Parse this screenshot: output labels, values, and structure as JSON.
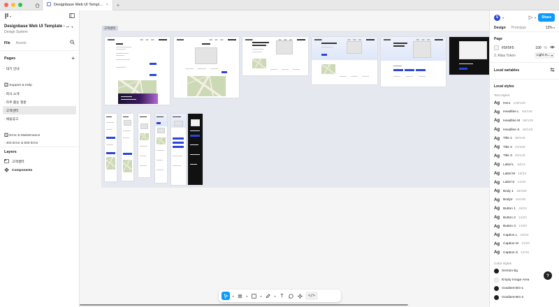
{
  "browser": {
    "tab_title": "Designbase Web UI Template - ∙",
    "traffic_lights": [
      "#ff5f57",
      "#febc2e",
      "#28c840"
    ],
    "new_tab": "+"
  },
  "left_panel": {
    "file_title": "Designbase Web UI Template - ...",
    "file_subtitle": "Design System",
    "tabs": [
      "File",
      "Assets"
    ],
    "pages_heading": "Pages",
    "add_symbol": "+",
    "pages": [
      "∙ 대기 안내",
      "",
      "🔲 Support & Help",
      "∙ 회사 소개",
      "∙ 자주 묻는 질문",
      "∙ 고객센터",
      "∙ 채용공고",
      "",
      "🔲 Error & Maintenance",
      "∙ 404 Error & 500 Error"
    ],
    "selected_page_index": 5,
    "layers_heading": "Layers",
    "layers": [
      {
        "label": "고객센터",
        "icon": "section-icon",
        "bold": false
      },
      {
        "label": "Components",
        "icon": "component-icon",
        "bold": true
      }
    ]
  },
  "canvas": {
    "section_label": "고객센터",
    "section_bg": "#e6e8f0"
  },
  "toolbar": {
    "tools": [
      "move-tool",
      "frame-tool",
      "shape-tool",
      "pen-tool",
      "text-tool",
      "comment-tool",
      "actions-tool",
      "dev-mode-tool"
    ],
    "text_glyph": "T",
    "code_glyph": "</>"
  },
  "right_panel": {
    "avatar_letter": "S",
    "share_label": "Share",
    "tabs": [
      "Design",
      "Prototype"
    ],
    "zoom": "12%",
    "page_heading": "Page",
    "page_color": "F5F5F5",
    "page_opacity": "100",
    "percent_sign": "%",
    "alias_label": "2. Alias Token",
    "alias_value": "Light m...",
    "local_variables": "Local variables",
    "local_styles": "Local styles",
    "text_styles_label": "Text styles",
    "text_styles": [
      {
        "name": "Hero",
        "spec": "128/128"
      },
      {
        "name": "Headline L",
        "spec": "64/128"
      },
      {
        "name": "Headline M",
        "spec": "56/128"
      },
      {
        "name": "Headline S",
        "spec": "48/128"
      },
      {
        "name": "Title 1",
        "spec": "36/140"
      },
      {
        "name": "Title 2",
        "spec": "24/160"
      },
      {
        "name": "Title 3",
        "spec": "20/140"
      },
      {
        "name": "Label L",
        "spec": "18/24"
      },
      {
        "name": "Label M",
        "spec": "16/24"
      },
      {
        "name": "Label S",
        "spec": "14/20"
      },
      {
        "name": "Body 1",
        "spec": "18/180"
      },
      {
        "name": "Body2",
        "spec": "16/160"
      },
      {
        "name": "Button 1",
        "spec": "16/24"
      },
      {
        "name": "Button 2",
        "spec": "14/20"
      },
      {
        "name": "Button 3",
        "spec": "14/20"
      },
      {
        "name": "Caption L",
        "spec": "16/24"
      },
      {
        "name": "Caption M",
        "spec": "14/20"
      },
      {
        "name": "Caption S",
        "spec": "12/16"
      }
    ],
    "ag_glyph": "Ag",
    "color_styles_label": "Color styles",
    "color_styles": [
      {
        "name": "Section-bg",
        "color": "#1e1e1e"
      },
      {
        "name": "Empty Image Area",
        "color": "#eeeeee"
      },
      {
        "name": "Gradient-BG-1",
        "color": "#222222"
      },
      {
        "name": "Gradient-BG-2",
        "color": "#222222"
      }
    ],
    "help": "?"
  }
}
